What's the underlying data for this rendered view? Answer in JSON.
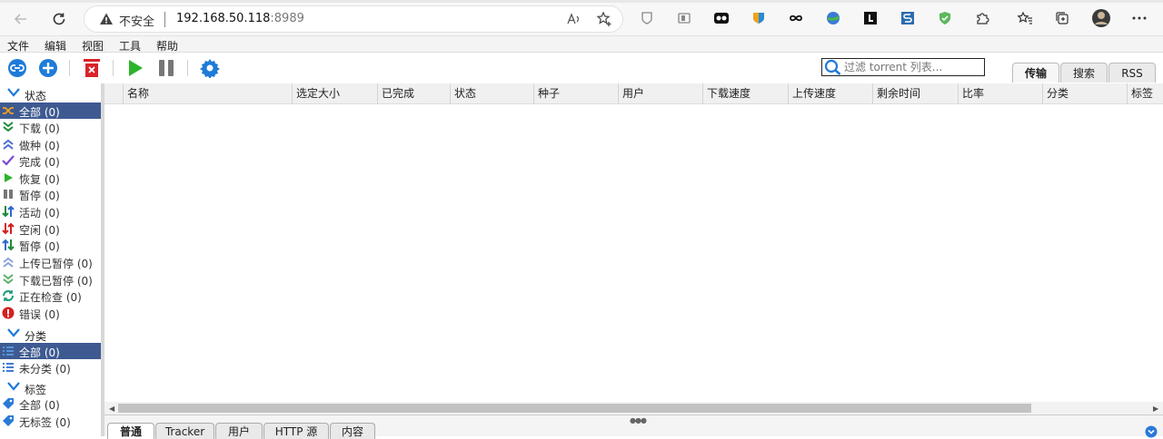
{
  "browser": {
    "insecure_label": "不安全",
    "url_host": "192.168.50.118",
    "url_port": ":8989"
  },
  "menu": [
    "文件",
    "编辑",
    "视图",
    "工具",
    "帮助"
  ],
  "toolbar": {
    "filter_placeholder": "过滤 torrent 列表...",
    "tabs": [
      "传输",
      "搜索",
      "RSS"
    ]
  },
  "sidebar": {
    "status_header": "状态",
    "status_items": [
      {
        "label": "全部 (0)",
        "icon": "all-icon",
        "selected": true
      },
      {
        "label": "下载 (0)",
        "icon": "download-icon"
      },
      {
        "label": "做种 (0)",
        "icon": "seeding-icon"
      },
      {
        "label": "完成 (0)",
        "icon": "completed-icon"
      },
      {
        "label": "恢复 (0)",
        "icon": "resume-icon"
      },
      {
        "label": "暂停 (0)",
        "icon": "pause-icon"
      },
      {
        "label": "活动 (0)",
        "icon": "active-icon"
      },
      {
        "label": "空闲 (0)",
        "icon": "inactive-icon"
      },
      {
        "label": "暂停 (0)",
        "icon": "stalled-icon"
      },
      {
        "label": "上传已暂停 (0)",
        "icon": "upload-stalled-icon"
      },
      {
        "label": "下载已暂停 (0)",
        "icon": "download-stalled-icon"
      },
      {
        "label": "正在检查 (0)",
        "icon": "checking-icon"
      },
      {
        "label": "错误 (0)",
        "icon": "error-icon"
      }
    ],
    "category_header": "分类",
    "category_items": [
      {
        "label": "全部 (0)",
        "selected": true
      },
      {
        "label": "未分类 (0)"
      }
    ],
    "tags_header": "标签",
    "tag_items": [
      {
        "label": "全部 (0)"
      },
      {
        "label": "无标签 (0)"
      }
    ]
  },
  "table": {
    "columns": [
      "名称",
      "选定大小",
      "已完成",
      "状态",
      "种子",
      "用户",
      "下载速度",
      "上传速度",
      "剩余时间",
      "比率",
      "分类",
      "标签"
    ]
  },
  "bottom_tabs": [
    "普通",
    "Tracker",
    "用户",
    "HTTP 源",
    "内容"
  ],
  "colors": {
    "selected_bg": "#3e5a91",
    "accent_blue": "#1e7bd8",
    "play_green": "#2bb52b",
    "delete_red": "#d9232a"
  }
}
